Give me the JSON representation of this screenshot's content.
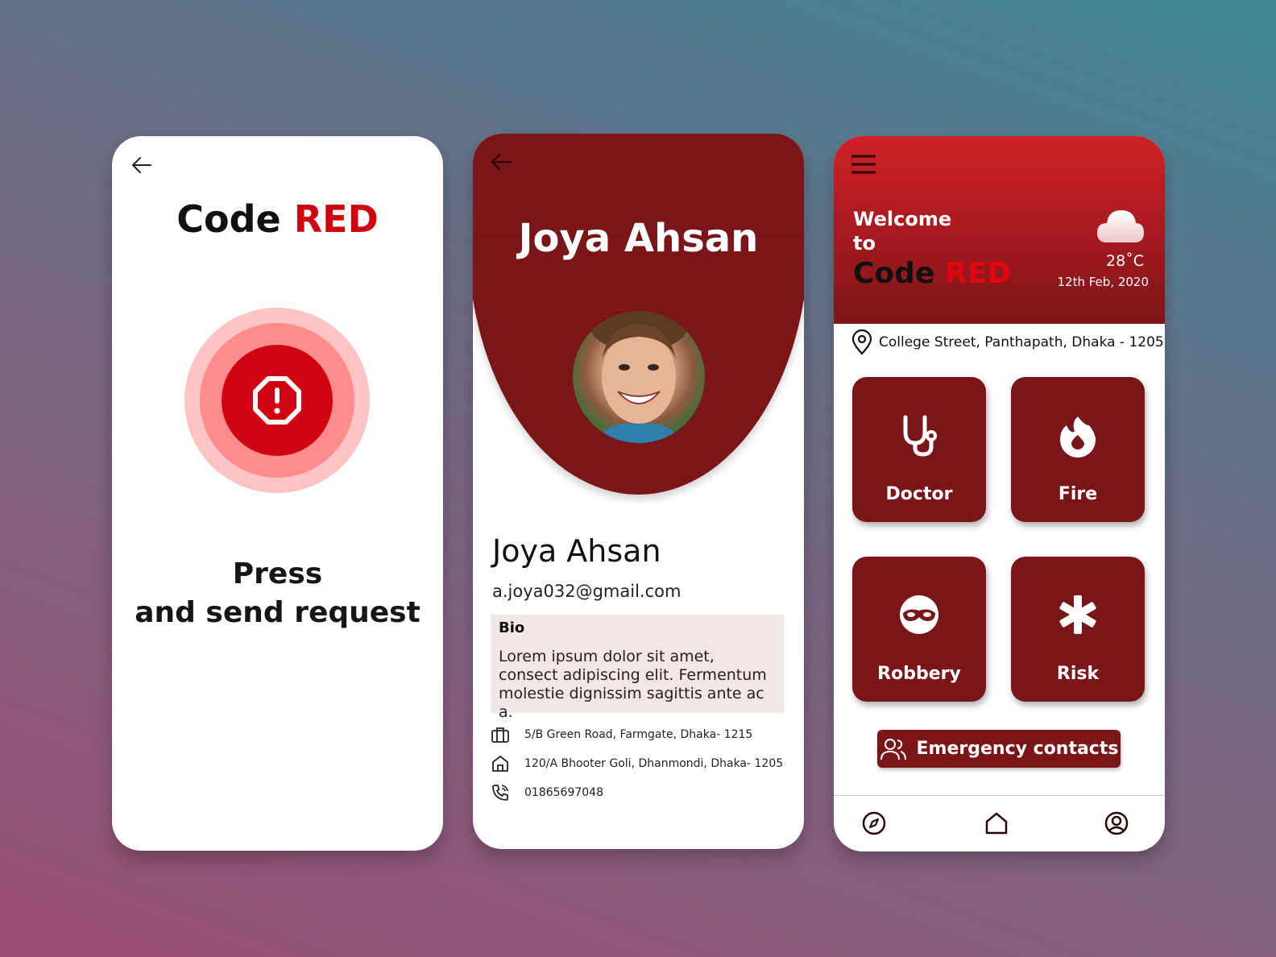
{
  "screen_sos": {
    "title_main": "Code",
    "title_accent": "RED",
    "press_line1": "Press",
    "press_line2": "and send request"
  },
  "screen_profile": {
    "header_name": "Joya Ahsan",
    "name": "Joya Ahsan",
    "email": "a.joya032@gmail.com",
    "bio_label": "Bio",
    "bio_text": "Lorem ipsum dolor sit amet, consect adipiscing elit. Fermentum molestie dignissim sagittis ante ac a.",
    "work_address": "5/B Green Road, Farmgate, Dhaka- 1215",
    "home_address": "120/A Bhooter Goli, Dhanmondi, Dhaka- 1205",
    "phone": "01865697048"
  },
  "screen_home": {
    "welcome_line1": "Welcome",
    "welcome_line2": "to",
    "title_main": "Code",
    "title_accent": "RED",
    "temperature": "28˚C",
    "date": "12th Feb, 2020",
    "location": "College Street, Panthapath, Dhaka - 1205",
    "tiles": [
      "Doctor",
      "Fire",
      "Robbery",
      "Risk"
    ],
    "emergency_label": "Emergency contacts"
  },
  "colors": {
    "brand_red": "#d0040f",
    "dark_red": "#7a1519",
    "bio_bg": "#f1e7e6"
  }
}
